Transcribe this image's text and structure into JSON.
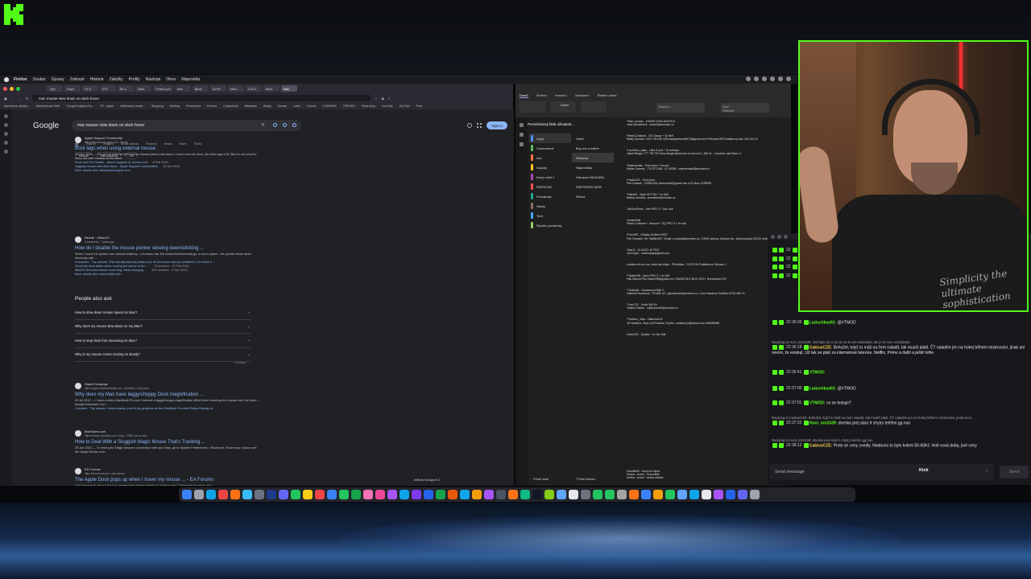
{
  "menubar": {
    "items": [
      "Firefox",
      "Soubor",
      "Úpravy",
      "Zobrazit",
      "Historie",
      "Záložky",
      "Profily",
      "Nástroje",
      "Okno",
      "Nápověda"
    ]
  },
  "browser": {
    "tabs": [
      "Tgtv",
      "Kayo",
      "UC4",
      "Z07",
      "Mi s",
      "Kikki",
      "Thank you",
      "elec",
      "Bjork",
      "Zuhel",
      "obec",
      "LOOT",
      "Mute",
      "mac"
    ],
    "url": "mac mouse slow down on dock hover",
    "bookmarks": [
      "Importovat záložky...",
      "Nástrahlovací Web",
      "Google Analytics Da...",
      "BT - Apple",
      "Validovalnot seskt...",
      "Shopping",
      "Meeting",
      "Personalvix",
      "Forums",
      "Customized",
      "Bitwarden",
      "Banky",
      "Doman",
      "Laser",
      "Vouces",
      "COMPANY",
      "OPENED",
      "ElectroDay",
      "YouTube",
      "SQ Print",
      "Pera"
    ]
  },
  "google": {
    "logo": "Google",
    "query": "mac mouse slow down on dock hover",
    "signin": "Sign in",
    "tabs": [
      "All",
      "Videos",
      "Images",
      "Short videos",
      "Forums",
      "News",
      "More",
      "Tools"
    ],
    "chips": [
      "Reddit",
      "Not working",
      "Fix"
    ],
    "results": [
      {
        "site": "Apple Support Community",
        "url": "https://discussions.apple.com › thread",
        "title": "dock lags when using external mouse",
        "snippet": "15 Nov 2020 — I've got an external steel series mouse (wired) and when I hover over the dock, the dock lags a bit. But it's not only the dock, the web browser is the same...",
        "subs": [
          {
            "text": "Dock and Full Screen - slow to appear on mouse over",
            "right": "8 Feb 2023"
          },
          {
            "text": "Lagging mouse with dock issue - Apple Support Communities",
            "right": "20 Jan 2020"
          },
          {
            "text": "More results from discussions.apple.com",
            "right": ""
          }
        ]
      },
      {
        "site": "Reddit · r/MacOS",
        "url": "3 comments · 2 years ago",
        "title": "How do I disable the mouse pointer slowing down/sticking ...",
        "snippet": "When I move the pointer over almost anything - a browser tab, the close/minimize/enlarge, a menu option - the pointer slows down obviously with ...",
        "subs": [
          {
            "text": "3 answers · Top answer: This actually sounds pretty cool, let me know how you enabled it, I'd check it ...",
            "right": ""
          },
          {
            "text": "Show the dock faster when moving the cursor to the ...",
            "right": "79 answers · 23 Feb 2024"
          },
          {
            "text": "MacOS Sonoma mouse hover bug. Most annoying ...",
            "right": "201 answers · 6 Nov 2023"
          },
          {
            "text": "More results from www.reddit.com",
            "right": ""
          }
        ]
      },
      {
        "site": "Stack Exchange",
        "url": "https://apple.stackexchange.com › questions › why-does...",
        "title": "Why does my Mac have laggy/choppy Dock magnification ...",
        "snippet": "29 Jul 2012 — I have a retina MacBook Pro and I noticed a laggy/choppy magnification effect when hovering the mouse over the dock. I thought Mountain Lion...",
        "subs": [
          {
            "text": "1 answer · Top answer: Unfortunately, a lot of the graphics on the MacBook Pro with Retina Display ar...",
            "right": ""
          }
        ]
      },
      {
        "site": "MacSales.com",
        "url": "https://eshop.macsales.com › blog › 79962-how-to-dea...",
        "title": "How to Deal With a Sluggish Magic Mouse That's Tracking ...",
        "snippet": "25 Jan 2022 — To reset your Magic Mouse's connection with your Mac, go to System Preferences > Bluetooth. Hover your cursor over the Magic Mouse icon.",
        "subs": []
      },
      {
        "site": "EA Forums",
        "url": "https://forums.ea.com › discussions",
        "title": "The Apple Dock pops up when I hover my mouse ... - EA Forums",
        "snippet": "I did manage to get my Dock to appear twice during gaming in Mojave and Catalina but it seems very",
        "subs": []
      }
    ],
    "paa": {
      "title": "People also ask",
      "questions": [
        "How to slow down mouse speed on Mac?",
        "Why does my mouse slow down on my Mac?",
        "How to stop dock from bouncing on Mac?",
        "Why is my mouse cursor moving so slowly?"
      ],
      "feedback": "Feedback"
    },
    "pager": "Affinity Designer 2"
  },
  "onenote": {
    "ribbon_tabs": [
      "Domů",
      "Vložení",
      "Kreslení",
      "Zobrazení",
      "Řešení doma"
    ],
    "style_boxes": [
      "Nadpis 1",
      "Úkol",
      "Důležité"
    ],
    "font_name": "Calibri",
    "notebook": "Poznámkový blok uživatele...",
    "sections": [
      {
        "label": "Vzpe",
        "color": "#4e8ef0"
      },
      {
        "label": "Customized",
        "color": "#5cb85c"
      },
      {
        "label": "Info",
        "color": "#ff7043"
      },
      {
        "label": "Liquidy",
        "color": "#ffca28"
      },
      {
        "label": "Nový oddíl 1",
        "color": "#ab47bc"
      },
      {
        "label": "PATREON",
        "color": "#ef5350"
      },
      {
        "label": "Poznámky",
        "color": "#26a69a"
      },
      {
        "label": "Skany",
        "color": "#8d6e63"
      },
      {
        "label": "Tech",
        "color": "#42a5f5"
      },
      {
        "label": "Rychlé poznámky",
        "color": "#9ccc65"
      }
    ],
    "pages": [
      "Videz",
      "Buy me a coffee",
      "Streamy",
      "Nápovědka",
      "Sdružení NIKKURA",
      "PARTNERS WEB",
      "Různé"
    ],
    "add_section": "Přidat oddíl",
    "add_page": "Přidat stránku",
    "note_blocks": [
      "*Sam_rucinss - DÁRSK DOKLADOVKA\nJana Vazačiková - slavíků@seznam.cz",
      "*Metro12haland - G4 Classic + 3x Sefi\nMatěj Zachami +420 728 538 328 matejzachami8273@gmail.com Petřínská 699 Kadlanovy nad Ohří 431 51",
      "*LachSelo_vaiko - Ultra 3 pod + 3x holovka\nJakub Berger 777 769 752 Kuba.berger@seznam.cz Ámrosl 2, 486 01 - Lanomec nad Nisou 4",
      "*Mattmentalo - Primi pera + imcout\nMartin Oramey - 774 372 548 - 01 39285 - mattmentaol@seznam.cz",
      "*PadisCZE - Primi pero\nPetr Urbaník, 724561158, petrurbanik@gmail.com a 0l Zkusí 4l 85595",
      "*Palm69 - Gaze SE POD + 3x Sefi\nMichal Jemelka - jemelkam@seznam.cz",
      "JukSoulPhoto - Kim PRO 3 + Sax Salt",
      "JordanDirik\nParker Gulbrant + Imcount + SQ PRO 3 + 4x salt",
      "*Fouz567 - Dlhalky Sentinel MOD\nPetr Horsaék, Tel: 964864097, Email: p.horsejk@seznam.cz, Z-BOX adresa: Karlova Var, Jáchymovská 232/30 mřílu by to být víc.",
      "*Mar11 - ELGATO 4K PRO\nJan Kmjčí - marilvapsa@gmail.com",
      "Ladulka až na cruz, nebo tak nějak... Přikvěpka - CUSTOM Podšálek se Stcham :)",
      "**Salomi98 - Gaze PRO 3 + 4x Sefi\nFilip Salomi Filip.Salomi98@gmail.com 733636728 Z-BOX VBTH, Hyerburská 229",
      "**Gabshle - Gamewood Elite 2\nGabriela Horáková, 778 608 127, gbroxkova1@seznam.cz, z-box Masérna Gočetha 570/1 682 01",
      "**LenCZF - Zenik 360 Kil\nVojtěch Rubáč - vojtarubac15@seznam.cz",
      "**Szabon_Jirka - Diabonat A2\nJiří Nedbina, Zbyv Lidl Pražská, Teplice, nedarka.jiri@icloud.com 806659088",
      "CalmCZE - Dýmka + 4x Nic Salt"
    ],
    "note_bottom": "DavidWolf - zmeni se klesb\nPenka - zmeni - Černo/Bila\nAnůka - zmeni - mudry drahak"
  },
  "chat": {
    "messages": [
      {
        "time": "22",
        "user": "",
        "text": ""
      },
      {
        "time": "22",
        "user": "",
        "text": ""
      },
      {
        "time": "22",
        "user": "",
        "text": ""
      },
      {
        "time": "22",
        "user": "",
        "text": ""
      },
      {
        "time": "22:36:05",
        "user": "Ladushkaa91:",
        "text": "@VTMOD",
        "color": "#53fc18",
        "reply": ""
      },
      {
        "time": "22:36:18",
        "user": "CaktusCZE:",
        "text": "Bohužel, když to máš na čem naladit, tak musíš platit. ČT naladím jen na hokej během mistrovství, jinak ani nevím, že existují. Už tak se platí za internetové televize. Netflix, Prime a další a ještě tohle",
        "color": "#ffd24d",
        "reply": "Replying to Honi_mir2439: nechápu za co je se na to ani nekoukám ale je to moc nezajímalo"
      },
      {
        "time": "22:36:41",
        "user": "VTMOD:",
        "text": "",
        "color": "#53fc18",
        "reply": ""
      },
      {
        "time": "22:37:00",
        "user": "Ladushkaa91:",
        "text": "@VTMOD",
        "color": "#53fc18",
        "reply": ""
      },
      {
        "time": "22:37:01",
        "user": "VTMOD:",
        "text": "co se testuje?",
        "color": "#53fc18",
        "reply": ""
      },
      {
        "time": "22:37:22",
        "user": "Honi_mir2439:",
        "text": "dneska prej stací it chytry telefon gg noo",
        "color": "#53fc18",
        "reply": "Replying to CaktusCZE: Bohužel, když to máš na čem naladit, tak musíš platit. ČT naladím jen na hokej během mistrovství, jinak ani n..."
      },
      {
        "time": "22:38:12",
        "user": "CaktusCZE:",
        "text": "Proto se ceny zvedly. Nedávno to bylo kolem 50-60Kč. Holt nová doba, jiné ceny",
        "color": "#ffd24d",
        "reply": "Replying to Honi_mir2439: dneska prej stací it chytry telefon gg noo"
      }
    ],
    "input_placeholder": "Send message",
    "platform": "Kick",
    "send": "Send"
  },
  "webcam": {
    "shirt_text": "Simplicity the ultimate sophistication"
  },
  "colors": {
    "kick_green": "#53fc18",
    "google_link": "#8ab4f8"
  },
  "dock_icons": [
    "finder",
    "launchpad",
    "safari",
    "chrome",
    "firefox",
    "telegram",
    "system-settings",
    "steam",
    "discord",
    "spotify",
    "notes",
    "calendar",
    "mail",
    "messages",
    "whatsapp",
    "photos",
    "music",
    "podcasts",
    "appstore",
    "onenote",
    "word",
    "excel",
    "powerpoint",
    "photoshop",
    "illustrator",
    "affinity",
    "obs",
    "vlc",
    "chatgpt",
    "terminal",
    "activity-monitor",
    "preview",
    "textedit",
    "calculator",
    "maps",
    "facetime",
    "contacts",
    "reminders",
    "keynote",
    "pages",
    "numbers",
    "xcode",
    "vscode",
    "github",
    "slack",
    "zoom",
    "teams",
    "trash"
  ]
}
